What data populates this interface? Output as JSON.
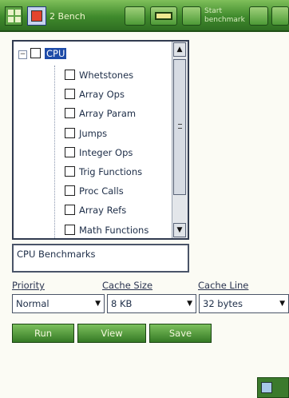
{
  "toolbar": {
    "app_title": "2 Bench",
    "button_label": "Start benchmark",
    "icons": [
      "grid-icon",
      "app-icon",
      "rectangle-icon",
      "doc-icon",
      "next-icon"
    ]
  },
  "tree": {
    "root": "CPU",
    "items": [
      "Whetstones",
      "Array Ops",
      "Array Param",
      "Jumps",
      "Integer Ops",
      "Trig Functions",
      "Proc Calls",
      "Array Refs",
      "Math Functions"
    ]
  },
  "description": "CPU Benchmarks",
  "settings": {
    "priority_label": "Priority",
    "priority_value": "Normal",
    "cache_size_label": "Cache Size",
    "cache_size_value": "8 KB",
    "cache_line_label": "Cache Line",
    "cache_line_value": "32 bytes"
  },
  "actions": {
    "run": "Run",
    "view": "View",
    "save": "Save"
  },
  "colors": {
    "toolbar": "#3f8a2c",
    "selection": "#1e4ba8",
    "button": "#4d9a36"
  }
}
